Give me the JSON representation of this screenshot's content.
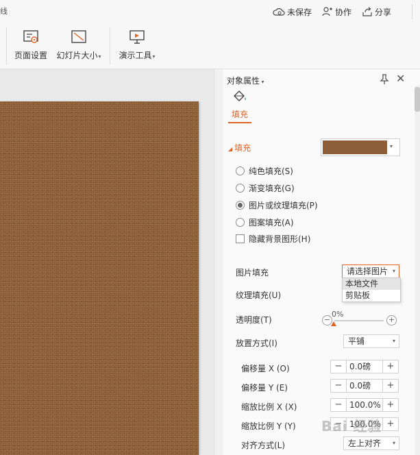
{
  "topbar": {
    "edge_text": "线",
    "unsaved": "未保存",
    "collaborate": "协作",
    "share": "分享"
  },
  "ribbon": {
    "page_setup": "页面设置",
    "slide_size": "幻灯片大小",
    "presentation_tools": "演示工具"
  },
  "panel": {
    "title": "对象属性",
    "tab_fill": "填充",
    "section_fill": "填充",
    "swatch_color": "#8d5e38",
    "options": [
      {
        "label": "纯色填充(S)",
        "selected": false
      },
      {
        "label": "渐变填充(G)",
        "selected": false
      },
      {
        "label": "图片或纹理填充(P)",
        "selected": true
      },
      {
        "label": "图案填充(A)",
        "selected": false
      }
    ],
    "hide_background": "隐藏背景图形(H)",
    "picture_fill_label": "图片填充",
    "picture_fill_value": "请选择图片",
    "picture_menu": [
      "本地文件",
      "剪贴板"
    ],
    "texture_fill_label": "纹理填充(U)",
    "transparency_label": "透明度(T)",
    "transparency_value": "0%",
    "placement_label": "放置方式(I)",
    "placement_value": "平铺",
    "offset_x_label": "偏移量 X (O)",
    "offset_x_value": "0.0磅",
    "offset_y_label": "偏移量 Y (E)",
    "offset_y_value": "0.0磅",
    "scale_x_label": "缩放比例 X (X)",
    "scale_x_value": "100.0%",
    "scale_y_label": "缩放比例 Y (Y)",
    "scale_y_value": "100.0%",
    "align_label": "对齐方式(L)",
    "align_value": "左上对齐"
  },
  "watermark": "Bai 经验",
  "colors": {
    "accent": "#e06326",
    "slide_texture": "#96663f"
  }
}
